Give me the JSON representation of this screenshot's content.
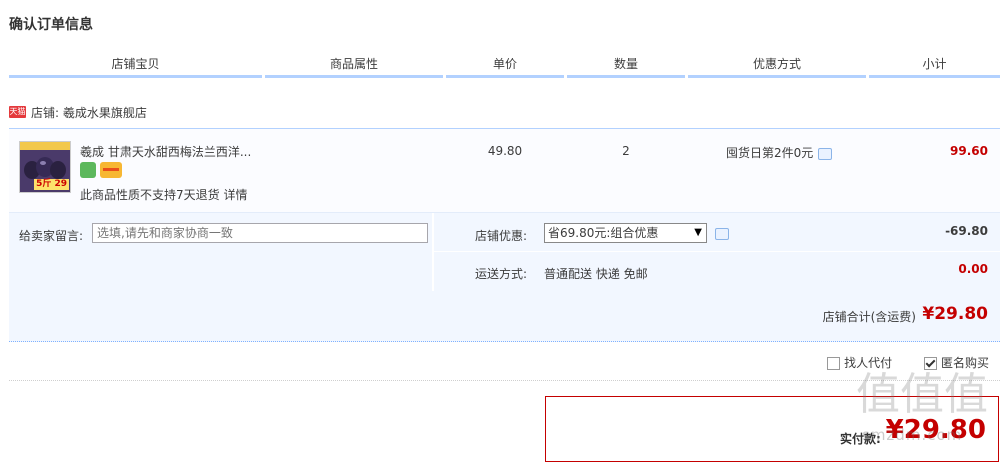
{
  "page_title": "确认订单信息",
  "columns": [
    "店铺宝贝",
    "商品属性",
    "单价",
    "数量",
    "优惠方式",
    "小计"
  ],
  "shop": {
    "badge": "天猫",
    "label": "店铺: 羲成水果旗舰店"
  },
  "item": {
    "title": "羲成 甘肃天水甜西梅法兰西洋...",
    "thumb_price": "5斤 29",
    "note": "此商品性质不支持7天退货 详情",
    "price": "49.80",
    "quantity": "2",
    "promo": "囤货日第2件0元",
    "subtotal": "99.60"
  },
  "options": {
    "memo_label": "给卖家留言:",
    "memo_placeholder": "选填,请先和商家协商一致",
    "shop_discount_label": "店铺优惠:",
    "shop_discount_selected": "省69.80元:组合优惠",
    "shop_discount_amount": "-69.80",
    "shipping_label": "运送方式:",
    "shipping_value": "普通配送 快递 免邮",
    "shipping_amount": "0.00"
  },
  "shop_total": {
    "label": "店铺合计(含运费)",
    "amount": "¥29.80"
  },
  "checks": {
    "proxy_pay": {
      "label": "找人代付",
      "checked": false
    },
    "anonymous": {
      "label": "匿名购买",
      "checked": true
    }
  },
  "payment": {
    "label": "实付款:",
    "amount": "¥29.80"
  },
  "watermark": {
    "glyphs": "值值值",
    "url": "smzdm.com"
  },
  "colors": {
    "accent_red": "#c40000",
    "header_border_blue": "#b2d1ff",
    "panel_bg": "#f2f7ff"
  }
}
